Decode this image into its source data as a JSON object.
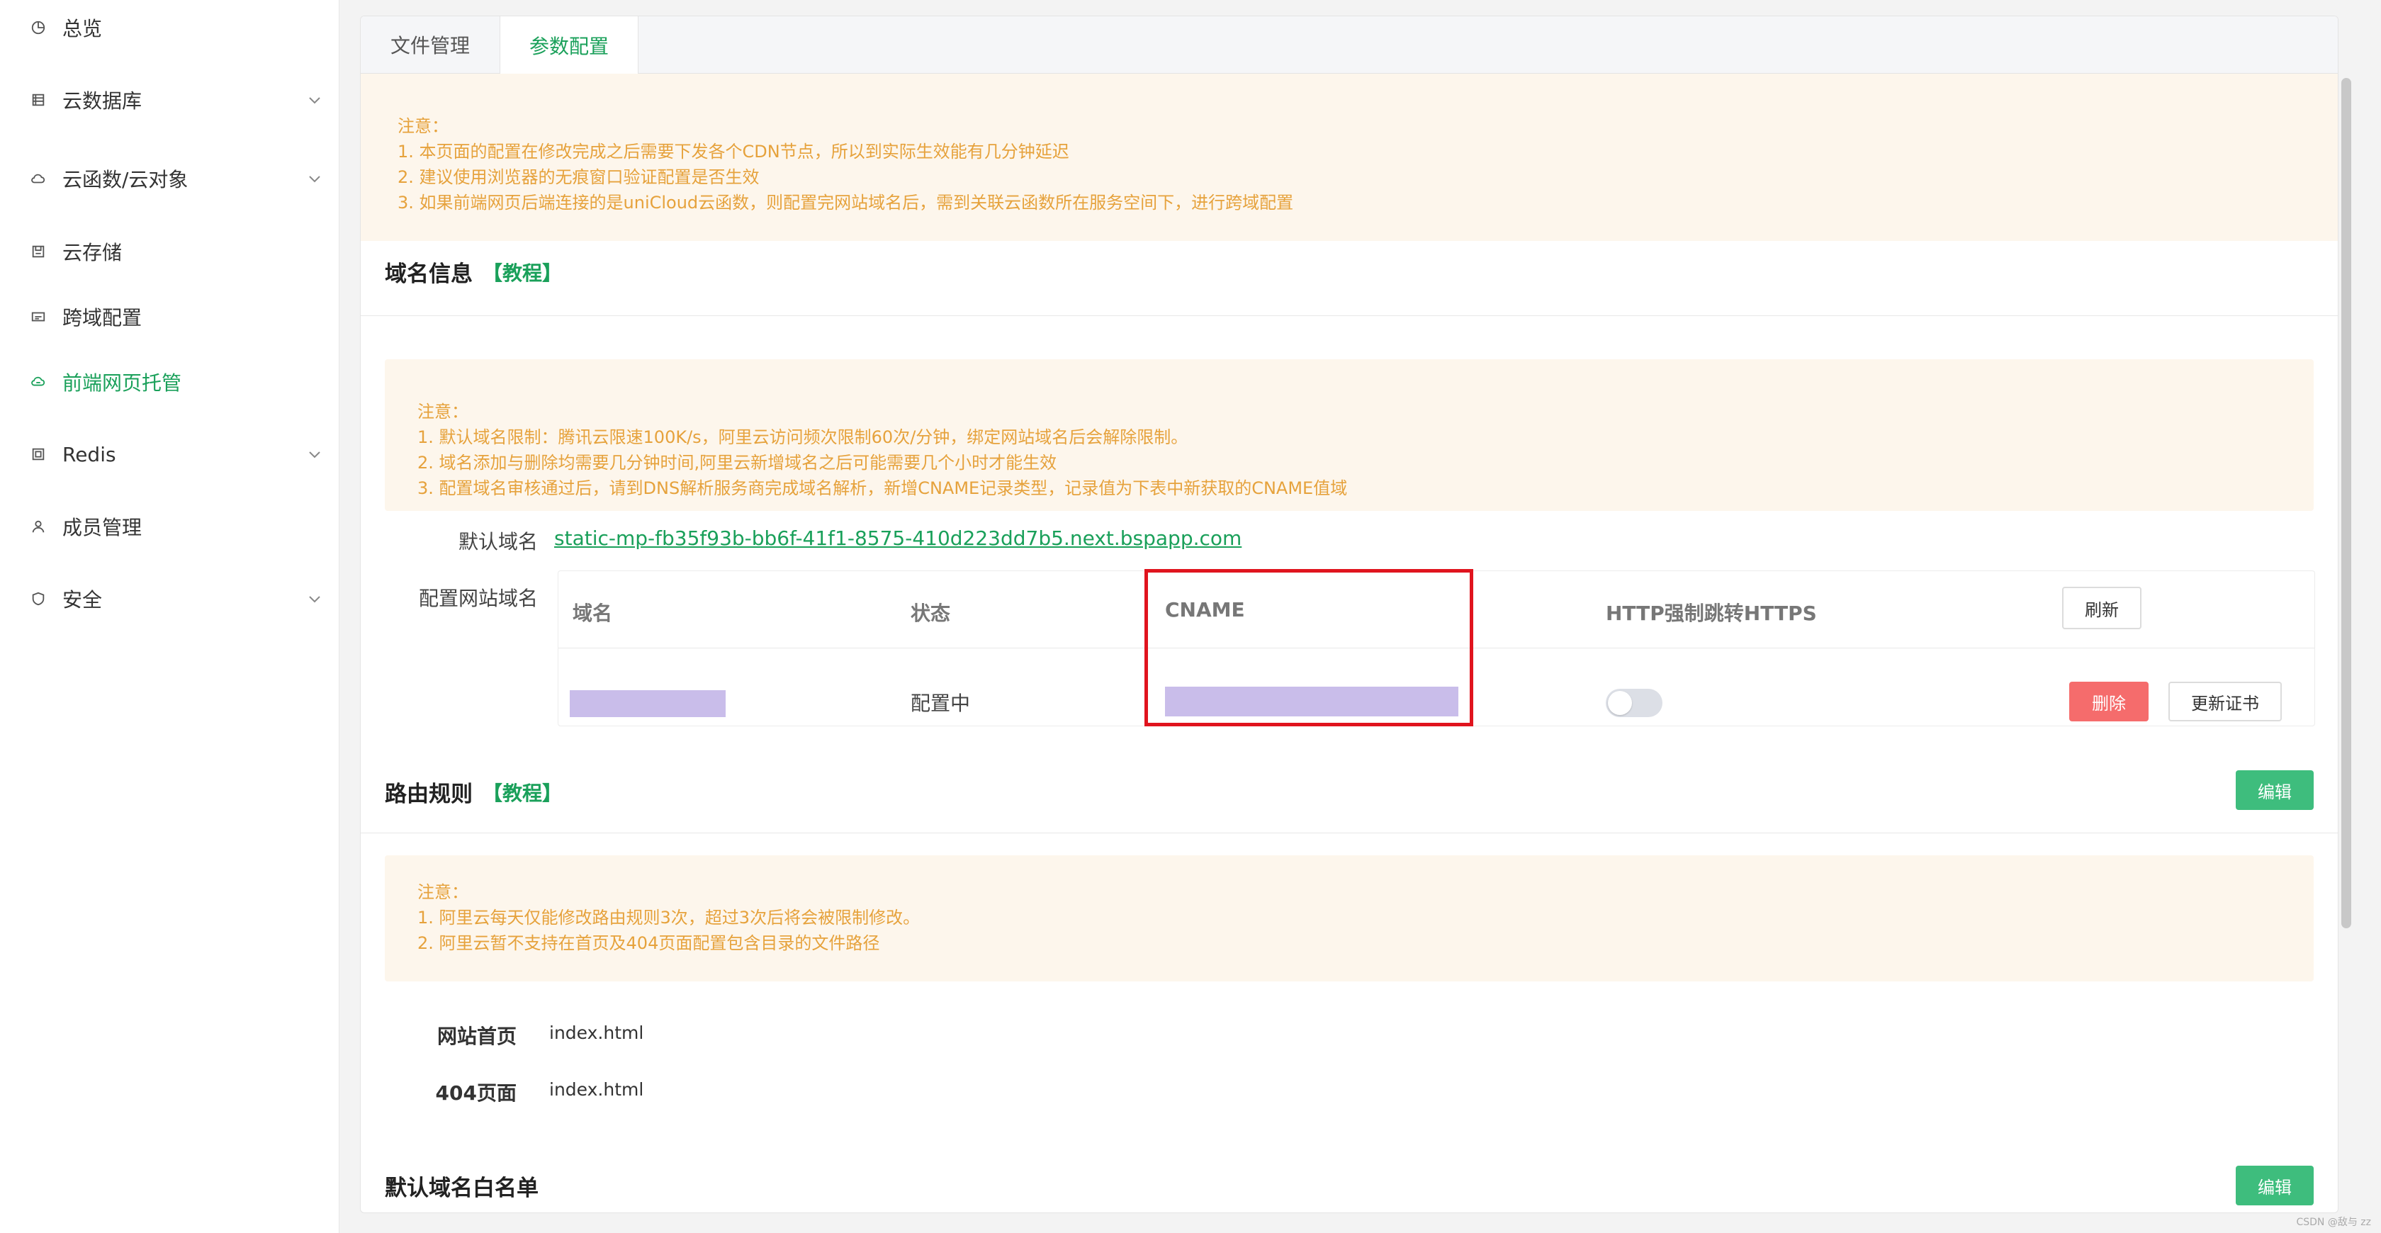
{
  "sidebar": {
    "items": [
      {
        "label": "总览",
        "icon": "pie-chart-icon",
        "expandable": false,
        "active": false
      },
      {
        "label": "云数据库",
        "icon": "database-icon",
        "expandable": true,
        "active": false
      },
      {
        "label": "云函数/云对象",
        "icon": "cloud-icon",
        "expandable": true,
        "active": false
      },
      {
        "label": "云存储",
        "icon": "storage-icon",
        "expandable": false,
        "active": false
      },
      {
        "label": "跨域配置",
        "icon": "cross-domain-icon",
        "expandable": false,
        "active": false
      },
      {
        "label": "前端网页托管",
        "icon": "hosting-icon",
        "expandable": false,
        "active": true
      },
      {
        "label": "Redis",
        "icon": "redis-icon",
        "expandable": true,
        "active": false
      },
      {
        "label": "成员管理",
        "icon": "user-icon",
        "expandable": false,
        "active": false
      },
      {
        "label": "安全",
        "icon": "shield-icon",
        "expandable": true,
        "active": false
      }
    ]
  },
  "tabs": {
    "file_mgmt": "文件管理",
    "params_config": "参数配置"
  },
  "notice_top": {
    "title": "注意：",
    "lines": [
      "1. 本页面的配置在修改完成之后需要下发各个CDN节点，所以到实际生效能有几分钟延迟",
      "2. 建议使用浏览器的无痕窗口验证配置是否生效",
      "3. 如果前端网页后端连接的是uniCloud云函数，则配置完网站域名后，需到关联云函数所在服务空间下，进行跨域配置"
    ]
  },
  "domain_section": {
    "title": "域名信息",
    "tutorial": "【教程】",
    "notice_title": "注意：",
    "notice_lines": [
      "1. 默认域名限制：腾讯云限速100K/s，阿里云访问频次限制60次/分钟，绑定网站域名后会解除限制。",
      "2. 域名添加与删除均需要几分钟时间,阿里云新增域名之后可能需要几个小时才能生效",
      "3. 配置域名审核通过后，请到DNS解析服务商完成域名解析，新增CNAME记录类型，记录值为下表中新获取的CNAME值域"
    ],
    "default_domain_label": "默认域名",
    "default_domain_value": "static-mp-fb35f93b-bb6f-41f1-8575-410d223dd7b5.next.bspapp.com",
    "custom_domain_label": "配置网站域名",
    "table": {
      "headers": [
        "域名",
        "状态",
        "CNAME",
        "HTTP强制跳转HTTPS"
      ],
      "refresh_button": "刷新",
      "row": {
        "status": "配置中",
        "https_redirect": false,
        "delete_button": "删除",
        "renew_cert_button": "更新证书"
      }
    }
  },
  "routing_section": {
    "title": "路由规则",
    "tutorial": "【教程】",
    "edit_button": "编辑",
    "notice_title": "注意：",
    "notice_lines": [
      "1. 阿里云每天仅能修改路由规则3次，超过3次后将会被限制修改。",
      "2. 阿里云暂不支持在首页及404页面配置包含目录的文件路径"
    ],
    "homepage_label": "网站首页",
    "homepage_value": "index.html",
    "page404_label": "404页面",
    "page404_value": "index.html"
  },
  "whitelist_section": {
    "title": "默认域名白名单",
    "edit_button": "编辑"
  },
  "watermark": "CSDN @敌与 zz",
  "colors": {
    "accent": "#1aa05a",
    "notice_bg": "#fdf6ec",
    "notice_text": "#e6a23c",
    "danger": "#f56c6c",
    "highlight_border": "#e0141e",
    "redaction": "#c9bdea"
  }
}
